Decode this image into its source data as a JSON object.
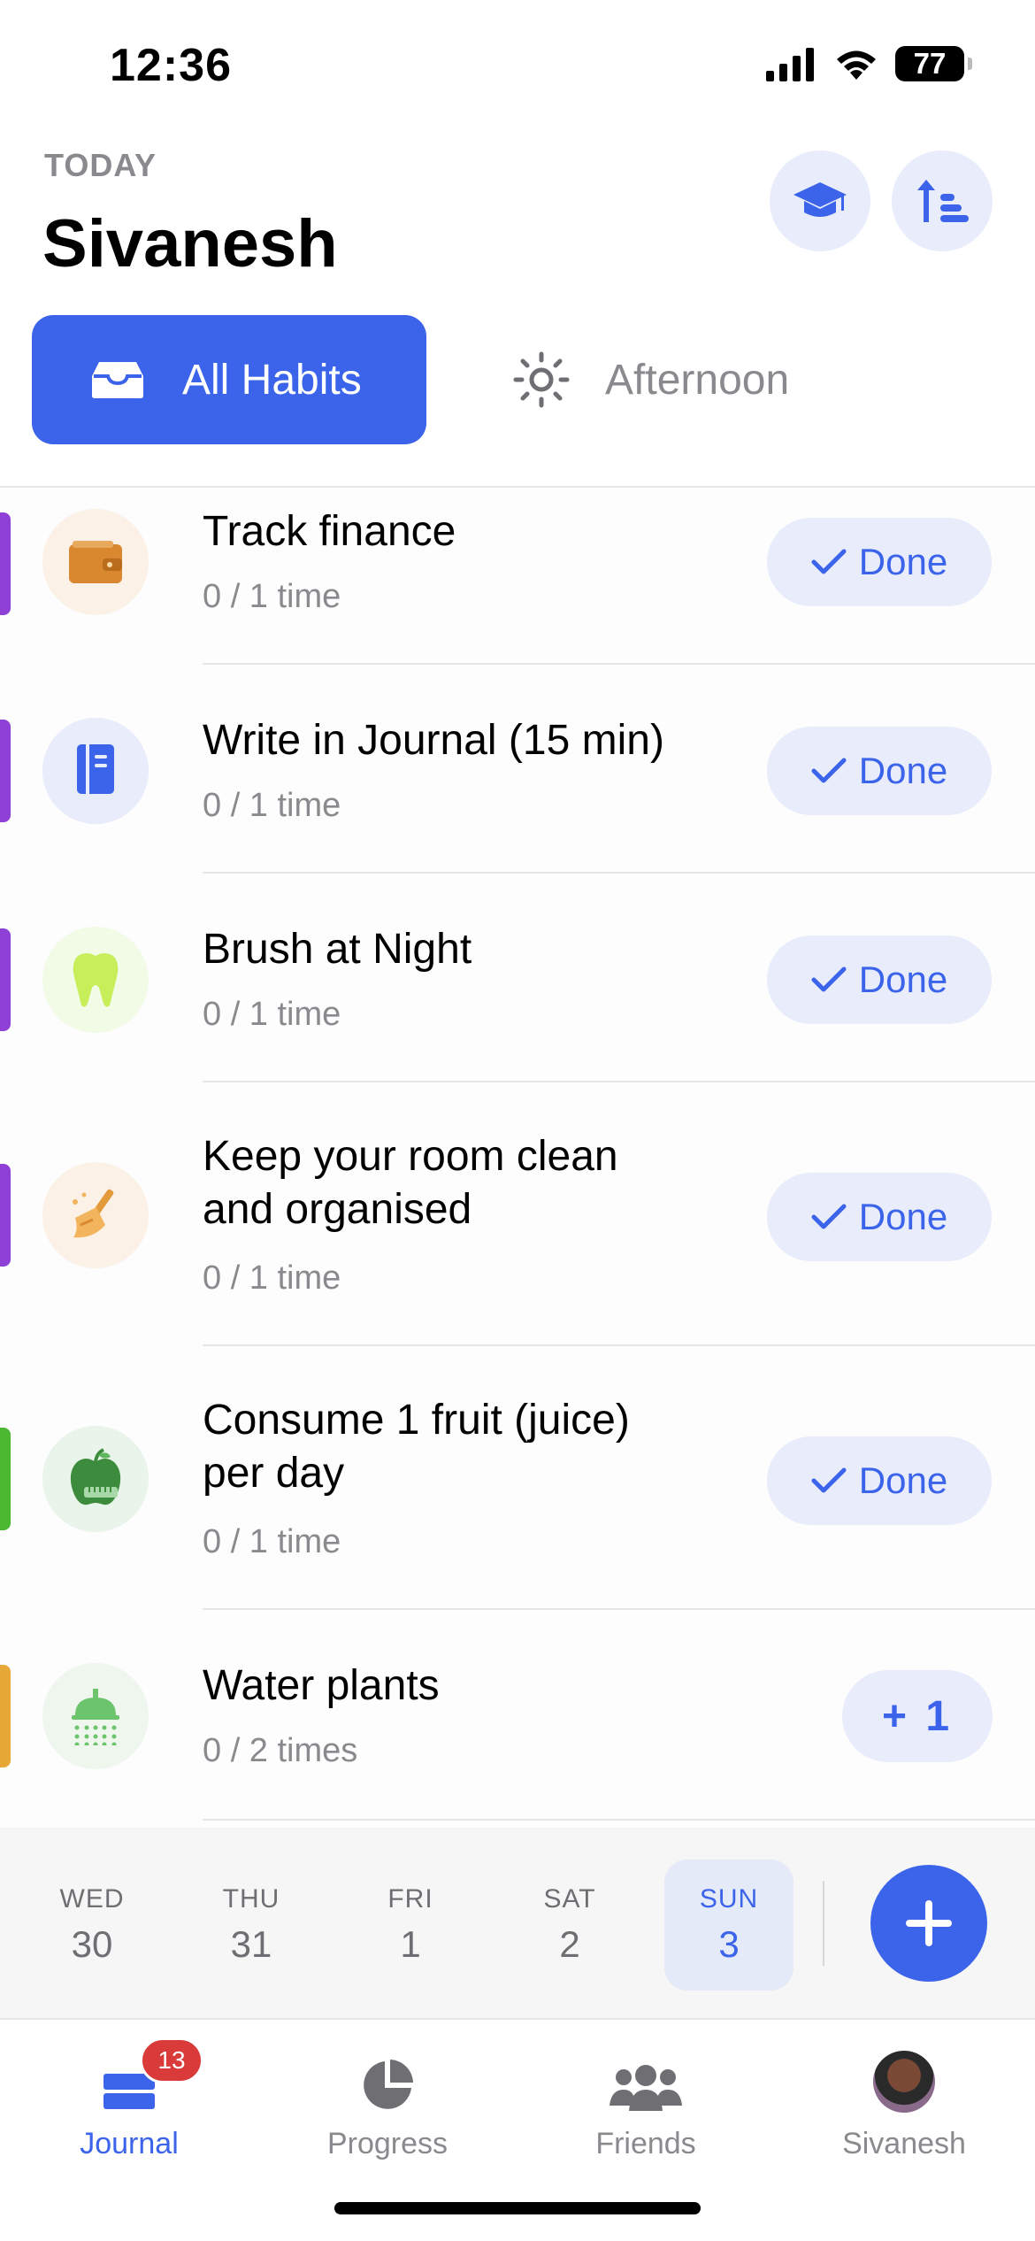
{
  "status_bar": {
    "time": "12:36",
    "battery": "77"
  },
  "header": {
    "section_label": "TODAY",
    "user_name": "Sivanesh"
  },
  "filters": {
    "all_habits": "All Habits",
    "afternoon": "Afternoon"
  },
  "habits": [
    {
      "title": "Track finance",
      "progress": "0 / 1 time",
      "action": "Done",
      "bar_color": "#8e3fd6",
      "icon": "wallet-icon",
      "icon_bg": "#fcf1e6"
    },
    {
      "title": "Write in Journal (15 min)",
      "progress": "0 / 1 time",
      "action": "Done",
      "bar_color": "#8e3fd6",
      "icon": "journal-icon",
      "icon_bg": "#e8ecfb"
    },
    {
      "title": "Brush at Night",
      "progress": "0 / 1 time",
      "action": "Done",
      "bar_color": "#8e3fd6",
      "icon": "tooth-icon",
      "icon_bg": "#f2fbe6"
    },
    {
      "title": "Keep your room clean and organised",
      "progress": "0 / 1 time",
      "action": "Done",
      "bar_color": "#8e3fd6",
      "icon": "broom-icon",
      "icon_bg": "#fcf1e6"
    },
    {
      "title": "Consume 1 fruit (juice) per day",
      "progress": "0 / 1 time",
      "action": "Done",
      "bar_color": "#4cb832",
      "icon": "apple-icon",
      "icon_bg": "#e9f4ea"
    },
    {
      "title": "Water plants",
      "progress": "0 / 2 times",
      "action": "+ 1",
      "bar_color": "#e8a838",
      "icon": "watering-icon",
      "icon_bg": "#eef6ee"
    }
  ],
  "date_strip": [
    {
      "dow": "WED",
      "dom": "30",
      "selected": false
    },
    {
      "dow": "THU",
      "dom": "31",
      "selected": false
    },
    {
      "dow": "FRI",
      "dom": "1",
      "selected": false
    },
    {
      "dow": "SAT",
      "dom": "2",
      "selected": false
    },
    {
      "dow": "SUN",
      "dom": "3",
      "selected": true
    }
  ],
  "nav": {
    "journal": "Journal",
    "journal_badge": "13",
    "progress": "Progress",
    "friends": "Friends",
    "profile": "Sivanesh"
  },
  "colors": {
    "accent": "#3b64ea",
    "accent_light": "#e8ecfb",
    "badge": "#d93a3a"
  }
}
